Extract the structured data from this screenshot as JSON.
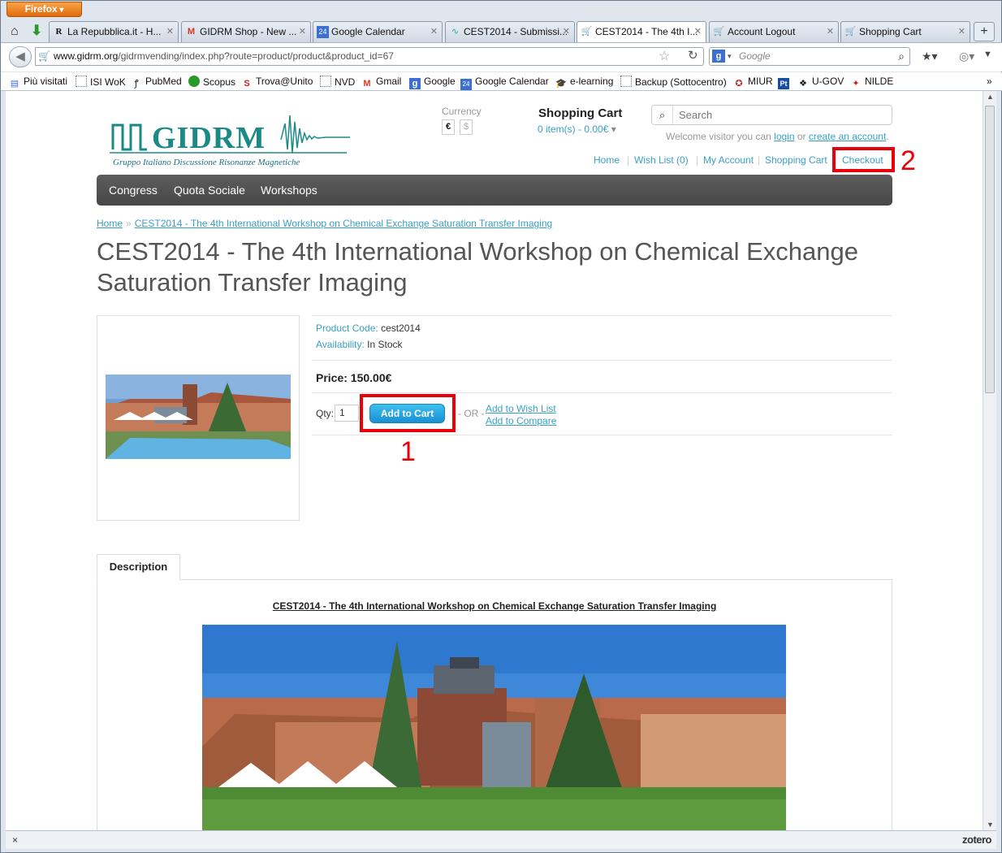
{
  "browser": {
    "app_button": "Firefox",
    "tabs": [
      {
        "label": "La Repubblica.it - H...",
        "favicon": "R"
      },
      {
        "label": "GIDRM Shop - New ...",
        "favicon": "M"
      },
      {
        "label": "Google Calendar",
        "favicon": "24"
      },
      {
        "label": "CEST2014 - Submissi...",
        "favicon": "~"
      },
      {
        "label": "CEST2014 - The 4th I...",
        "favicon": "cart"
      },
      {
        "label": "Account Logout",
        "favicon": "cart"
      },
      {
        "label": "Shopping Cart",
        "favicon": "cart"
      }
    ],
    "url_domain": "www.gidrm.org",
    "url_path": "/gidrmvending/index.php?route=product/product&product_id=67",
    "search_placeholder": "Google",
    "bookmarks": [
      "Più visitati",
      "ISI WoK",
      "PubMed",
      "Scopus",
      "Trova@Unito",
      "NVD",
      "Gmail",
      "Google",
      "Google Calendar",
      "e-learning",
      "Backup (Sottocentro)",
      "MIUR",
      "U-GOV",
      "NILDE"
    ],
    "status_close": "×",
    "status_addon": "zotero"
  },
  "site": {
    "logo_text": "GIDRM",
    "logo_subtitle": "Gruppo Italiano Discussione Risonanze Magnetiche",
    "currency_label": "Currency",
    "currency_euro": "€",
    "currency_dollar": "$",
    "cart_title": "Shopping Cart",
    "cart_summary": "0 item(s) - 0.00€",
    "search_placeholder": "Search",
    "welcome_prefix": "Welcome visitor you can",
    "login": "login",
    "or": "or",
    "create_account": "create an account",
    "welcome_suffix": ".",
    "links": {
      "home": "Home",
      "wishlist": "Wish List (0)",
      "account": "My Account",
      "cart": "Shopping Cart",
      "checkout": "Checkout"
    },
    "menu": [
      "Congress",
      "Quota Sociale",
      "Workshops"
    ]
  },
  "product": {
    "breadcrumb_home": "Home",
    "breadcrumb_sep": "»",
    "breadcrumb_current": "CEST2014 - The 4th International Workshop on Chemical Exchange Saturation Transfer Imaging",
    "title": "CEST2014 - The 4th International Workshop on Chemical Exchange Saturation Transfer Imaging",
    "code_label": "Product Code:",
    "code": "cest2014",
    "availability_label": "Availability:",
    "availability": "In Stock",
    "price": "Price: 150.00€",
    "qty_label": "Qty:",
    "qty": "1",
    "add_to_cart": "Add to Cart",
    "or": "- OR -",
    "add_wishlist": "Add to Wish List",
    "add_compare": "Add to Compare",
    "description_tab": "Description",
    "description_title": "CEST2014 - The 4th International Workshop on Chemical Exchange Saturation Transfer Imaging"
  },
  "annotations": {
    "step1": "1",
    "step2": "2",
    "color": "#e8000b"
  }
}
